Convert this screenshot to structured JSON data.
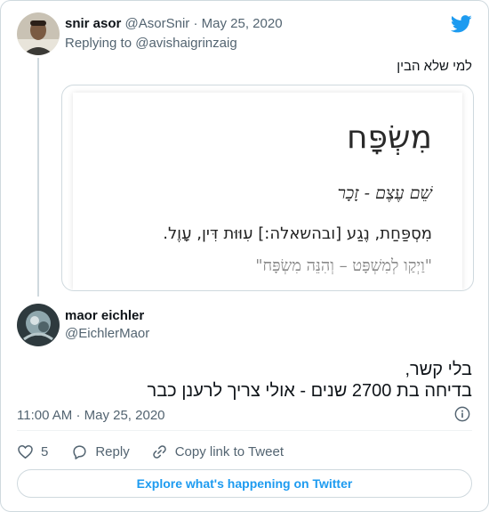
{
  "tweet1": {
    "author_name": "snir asor",
    "author_handle": "@AsorSnir",
    "separator": "·",
    "date": "May 25, 2020",
    "replying_to_prefix": "Replying to",
    "replying_to_handle": "@avishaigrinzaig",
    "text": "למי שלא הבין",
    "embedded_image": {
      "word": "מִשְׂפָּח",
      "part_of_speech": "שֵׁם עֶצֶם - זָכָר",
      "definition": "מִסְפַּחַת, נֶגַע [ובהשאלה:] עִוּוּת דִּין, עָוֶל.",
      "quote": "\"וַיְקַו לְמִשְׁפָּט – וְהִנֵּה מִשְׂפָּח\""
    }
  },
  "tweet2": {
    "author_name": "maor eichler",
    "author_handle": "@EichlerMaor",
    "text_line1": "בלי קשר,",
    "text_line2": "בדיחה בת 2700 שנים - אולי צריך לרענן כבר",
    "time": "11:00 AM",
    "separator": "·",
    "date": "May 25, 2020"
  },
  "actions": {
    "like_count": "5",
    "reply_label": "Reply",
    "copy_link_label": "Copy link to Tweet"
  },
  "explore_label": "Explore what's happening on Twitter",
  "colors": {
    "twitter_blue": "#1d9bf0",
    "muted_text": "#536471",
    "border": "#cfd9de"
  },
  "icons": [
    "twitter-bird-icon",
    "info-icon",
    "heart-icon",
    "reply-bubble-icon",
    "link-icon"
  ]
}
